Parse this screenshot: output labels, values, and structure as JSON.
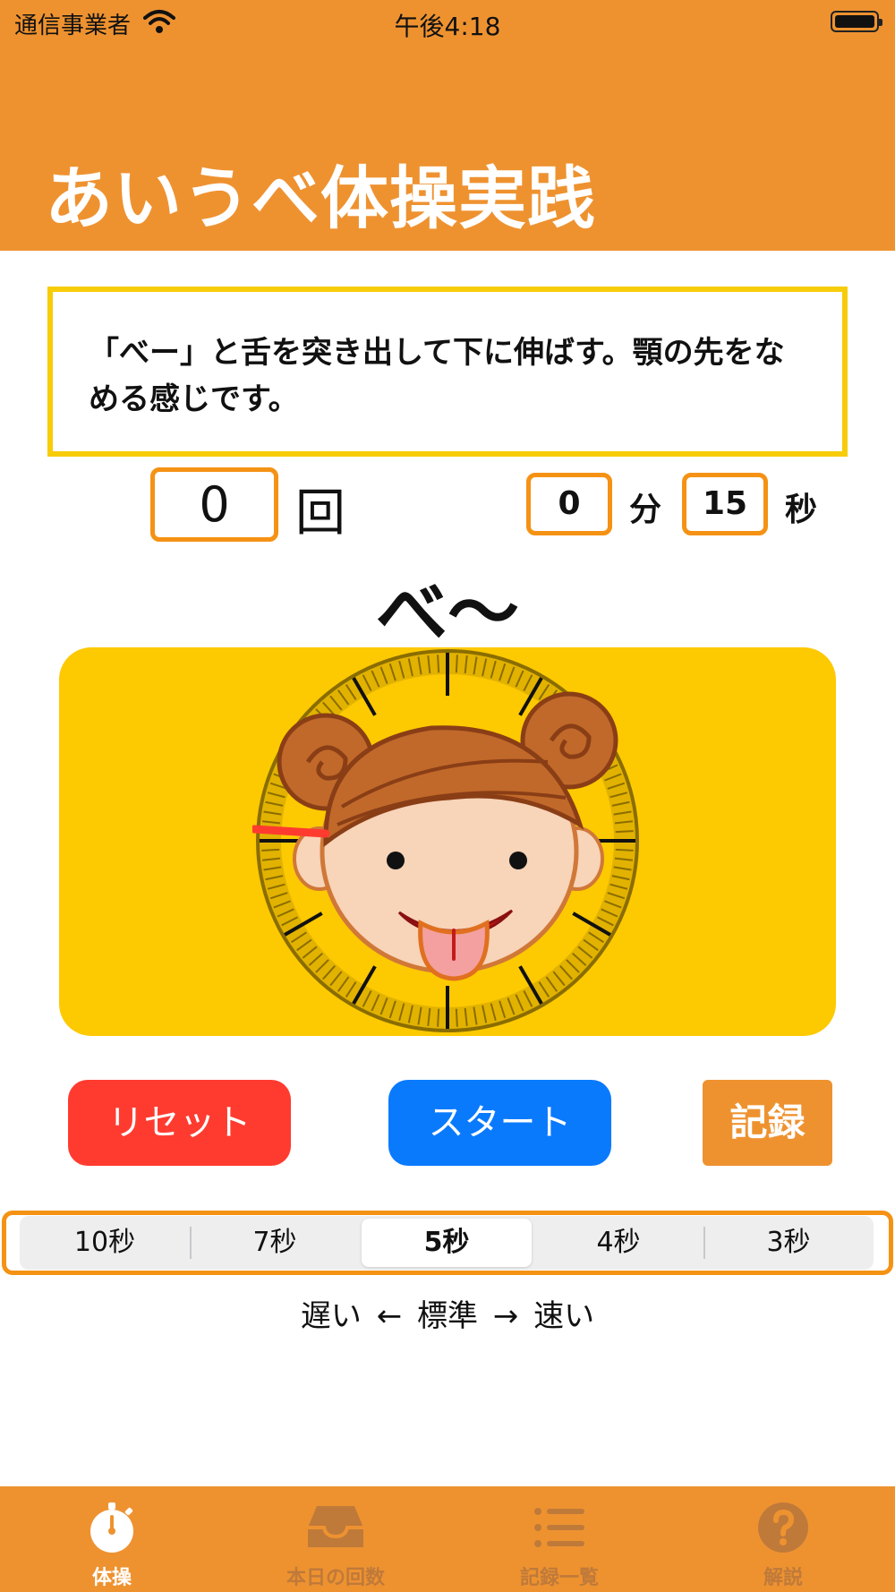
{
  "status_bar": {
    "carrier": "通信事業者",
    "time": "午後4:18"
  },
  "header": {
    "title": "あいうべ体操実践"
  },
  "instruction": {
    "text": "「べー」と舌を突き出して下に伸ばす。顎の先をなめる感じです。"
  },
  "counter": {
    "count": "0",
    "count_unit": "回",
    "minutes": "0",
    "minutes_unit": "分",
    "seconds": "15",
    "seconds_unit": "秒"
  },
  "phase_label": "べ〜",
  "clock": {
    "panel_color": "#fdc901",
    "hand_color": "#ff3b30",
    "face_icon": "girl-sticking-out-tongue"
  },
  "buttons": {
    "reset": "リセット",
    "start": "スタート",
    "record": "記録"
  },
  "speed": {
    "options": [
      "10秒",
      "7秒",
      "5秒",
      "4秒",
      "3秒"
    ],
    "selected": "5秒",
    "legend": "遅い ← 標準 → 速い"
  },
  "tab_bar": {
    "tabs": [
      {
        "label": "体操",
        "icon": "stopwatch-icon",
        "active": true
      },
      {
        "label": "本日の回数",
        "icon": "inbox-tray-icon",
        "active": false
      },
      {
        "label": "記録一覧",
        "icon": "list-icon",
        "active": false
      },
      {
        "label": "解説",
        "icon": "question-circle-icon",
        "active": false
      }
    ]
  },
  "colors": {
    "accent_orange": "#ee9230",
    "reset_red": "#ff3b30",
    "start_blue": "#0a7afd",
    "instruction_border": "#f7cc08"
  }
}
